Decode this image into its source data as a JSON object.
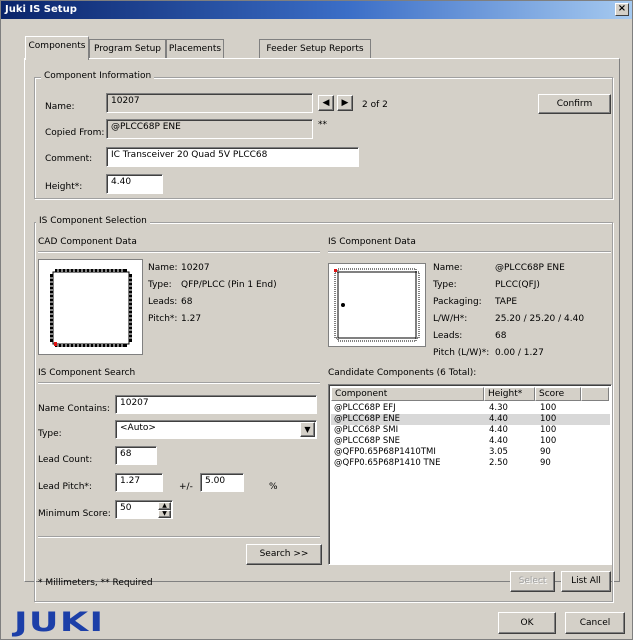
{
  "window": {
    "title": "Juki IS Setup",
    "close_glyph": "×"
  },
  "tabs": [
    "Components",
    "Program Setup",
    "Placements",
    "Feeder Setup Reports"
  ],
  "component_info": {
    "group_label": "Component Information",
    "name_label": "Name:",
    "name_value": "10207",
    "nav_counter": "2 of 2",
    "confirm_label": "Confirm",
    "copied_from_label": "Copied From:",
    "copied_from_value": "@PLCC68P         ENE",
    "required_marker": "**",
    "comment_label": "Comment:",
    "comment_value": "IC Transceiver 20 Quad 5V PLCC68",
    "height_label": "Height*:",
    "height_value": "4.40"
  },
  "is_selection": {
    "group_label": "IS Component Selection",
    "cad_header": "CAD Component Data",
    "cad_fields": [
      {
        "label": "Name:",
        "value": "10207"
      },
      {
        "label": "Type:",
        "value": "QFP/PLCC (Pin 1 End)"
      },
      {
        "label": "Leads:",
        "value": "68"
      },
      {
        "label": "Pitch*:",
        "value": "1.27"
      }
    ],
    "is_header": "IS Component Data",
    "is_fields": [
      {
        "label": "Name:",
        "value": "@PLCC68P         ENE"
      },
      {
        "label": "Type:",
        "value": "PLCC(QFJ)"
      },
      {
        "label": "Packaging:",
        "value": "TAPE"
      },
      {
        "label": "L/W/H*:",
        "value": "25.20 / 25.20 / 4.40"
      },
      {
        "label": "Leads:",
        "value": "68"
      },
      {
        "label": "Pitch (L/W)*:",
        "value": "0.00 / 1.27"
      }
    ]
  },
  "search": {
    "header": "IS Component Search",
    "name_contains_label": "Name Contains:",
    "name_contains_value": "10207",
    "type_label": "Type:",
    "type_value": "<Auto>",
    "lead_count_label": "Lead Count:",
    "lead_count_value": "68",
    "lead_pitch_label": "Lead Pitch*:",
    "lead_pitch_value": "1.27",
    "plus_minus": "+/-",
    "tolerance_value": "5.00",
    "percent": "%",
    "min_score_label": "Minimum Score:",
    "min_score_value": "50",
    "search_button": "Search >>"
  },
  "candidates": {
    "header": "Candidate Components (6 Total):",
    "columns": [
      "Component",
      "Height*",
      "Score"
    ],
    "rows": [
      {
        "component": "@PLCC68P      EFJ",
        "height": "4.30",
        "score": "100"
      },
      {
        "component": "@PLCC68P      ENE",
        "height": "4.40",
        "score": "100"
      },
      {
        "component": "@PLCC68P      SMI",
        "height": "4.40",
        "score": "100"
      },
      {
        "component": "@PLCC68P      SNE",
        "height": "4.40",
        "score": "100"
      },
      {
        "component": "@QFP0.65P68P1410TMI",
        "height": "3.05",
        "score": "90"
      },
      {
        "component": "@QFP0.65P68P1410 TNE",
        "height": "2.50",
        "score": "90"
      }
    ],
    "select_button": "Select",
    "list_all_button": "List All"
  },
  "footnote": "* Millimeters, ** Required",
  "footer": {
    "logo": "JUKI",
    "ok_label": "OK",
    "cancel_label": "Cancel"
  },
  "colors": {
    "title_blue": "#0a246a",
    "logo_blue": "#1c3fa8",
    "pin1_red": "#e01010",
    "face": "#d4d0c8"
  }
}
